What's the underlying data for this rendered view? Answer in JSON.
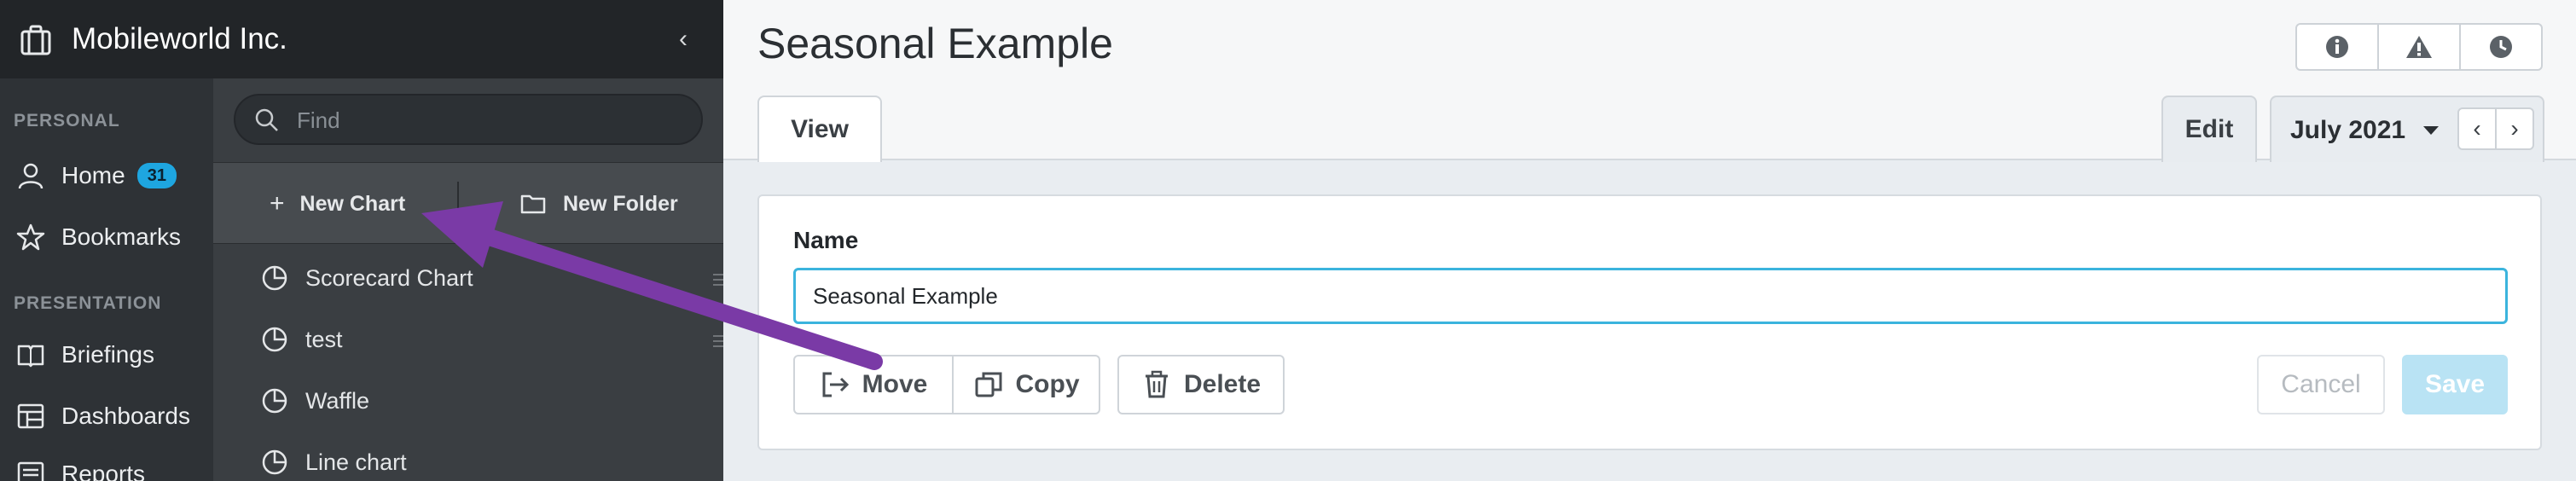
{
  "org": {
    "name": "Mobileworld Inc.",
    "collapse": "‹"
  },
  "nav": {
    "sections": [
      {
        "label": "PERSONAL"
      },
      {
        "label": "PRESENTATION"
      }
    ],
    "items": [
      {
        "label": "Home",
        "icon": "user-icon",
        "badge": "31"
      },
      {
        "label": "Bookmarks",
        "icon": "star-icon"
      },
      {
        "label": "Briefings",
        "icon": "book-icon"
      },
      {
        "label": "Dashboards",
        "icon": "dashboard-icon"
      },
      {
        "label": "Reports",
        "icon": "report-icon"
      }
    ]
  },
  "panel": {
    "search_placeholder": "Find",
    "new_chart": "New Chart",
    "new_folder": "New Folder",
    "charts": [
      {
        "label": "Scorecard Chart"
      },
      {
        "label": "test"
      },
      {
        "label": "Waffle"
      },
      {
        "label": "Line chart"
      }
    ]
  },
  "header": {
    "title": "Seasonal Example",
    "status_icons": [
      "info-icon",
      "warning-icon",
      "clock-icon"
    ],
    "tab_view": "View",
    "tab_edit": "Edit",
    "period": "July 2021",
    "prev": "‹",
    "next": "›"
  },
  "form": {
    "name_label": "Name",
    "name_value": "Seasonal Example",
    "move": "Move",
    "copy": "Copy",
    "delete": "Delete",
    "cancel": "Cancel",
    "save": "Save"
  },
  "colors": {
    "accent": "#1ea6e0",
    "input_focus": "#3bb4dd",
    "annotation_arrow": "#7a3aa6"
  }
}
